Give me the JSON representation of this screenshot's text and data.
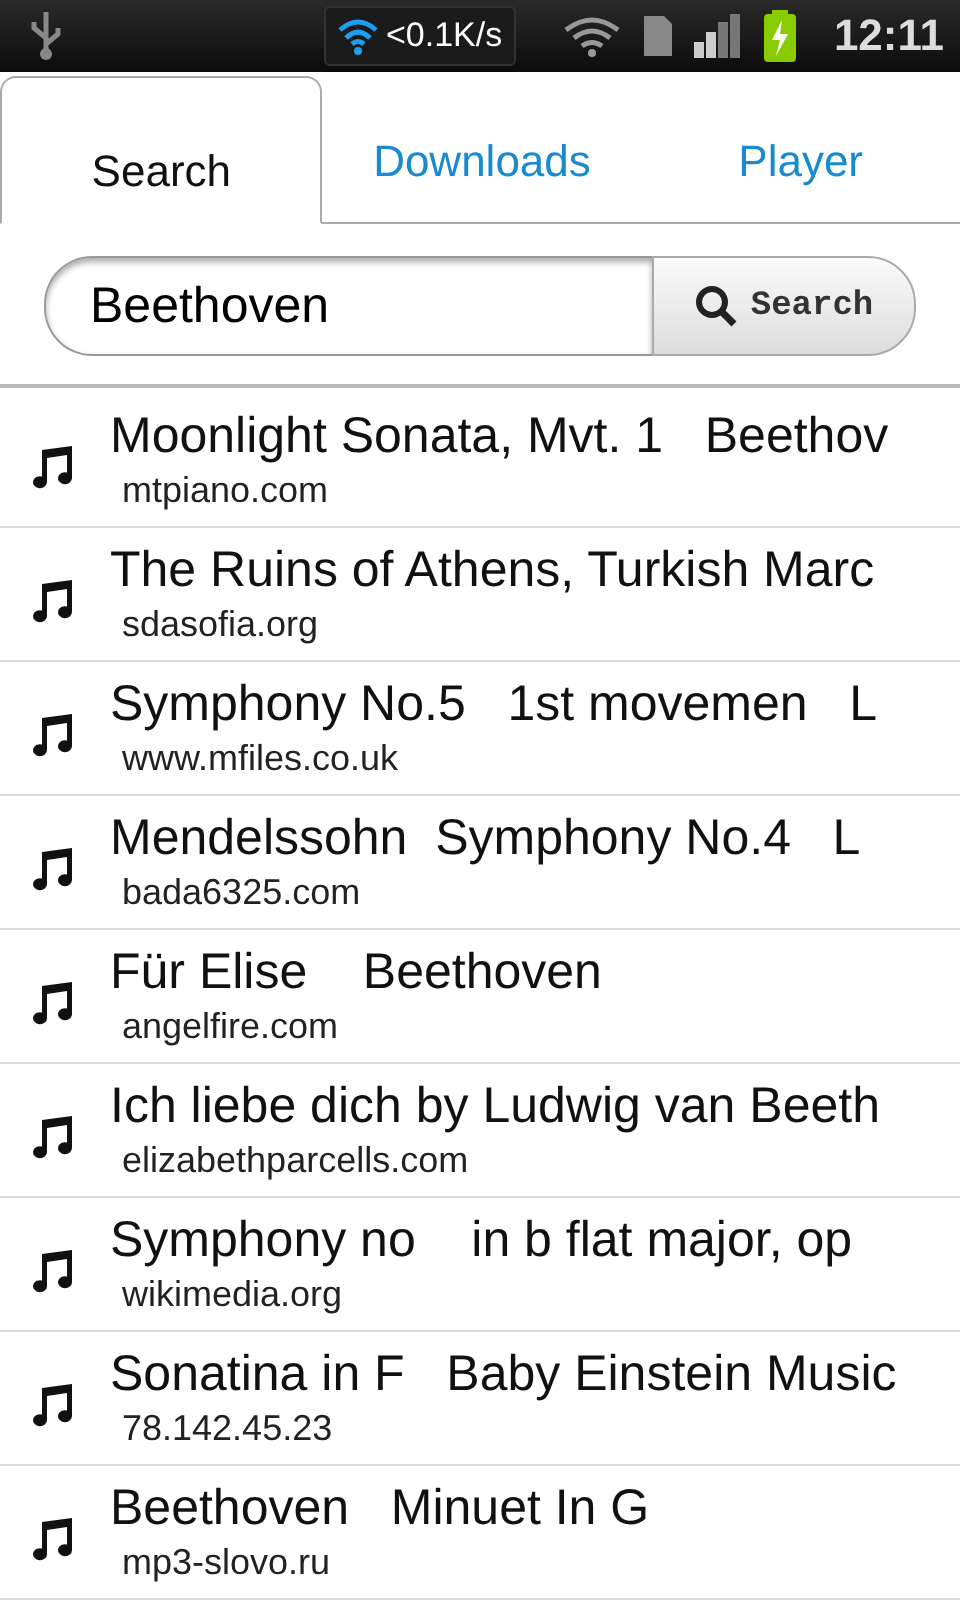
{
  "status_bar": {
    "speed": "<0.1K/s",
    "time": "12:11"
  },
  "tabs": [
    {
      "label": "Search",
      "selected": true
    },
    {
      "label": "Downloads",
      "selected": false
    },
    {
      "label": "Player",
      "selected": false
    }
  ],
  "search": {
    "value": "Beethoven",
    "button": "Search"
  },
  "results": [
    {
      "title": "Moonlight Sonata, Mvt. 1   Beethov",
      "source": "mtpiano.com"
    },
    {
      "title": "The Ruins of Athens, Turkish Marc",
      "source": "sdasofia.org"
    },
    {
      "title": "Symphony No.5   1st movemen   L",
      "source": "www.mfiles.co.uk"
    },
    {
      "title": "Mendelssohn  Symphony No.4   L",
      "source": "bada6325.com"
    },
    {
      "title": "Für Elise    Beethoven",
      "source": "angelfire.com"
    },
    {
      "title": "Ich liebe dich by Ludwig van Beeth",
      "source": "elizabethparcells.com"
    },
    {
      "title": "Symphony no    in b flat major, op",
      "source": "wikimedia.org"
    },
    {
      "title": "Sonatina in F   Baby Einstein Music",
      "source": "78.142.45.23"
    },
    {
      "title": "Beethoven   Minuet In G",
      "source": "mp3-slovo.ru"
    }
  ]
}
